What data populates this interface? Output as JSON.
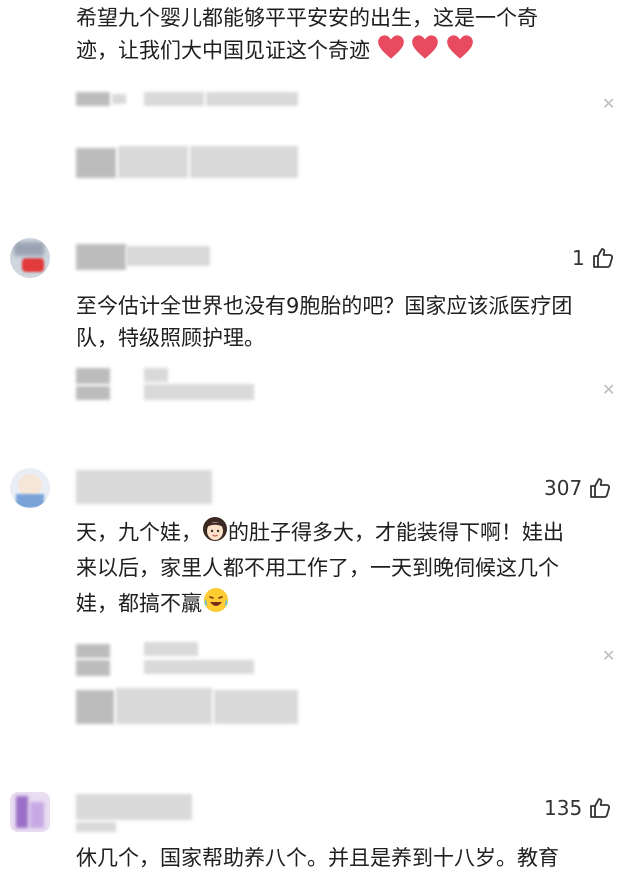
{
  "comments": [
    {
      "text": "希望九个婴儿都能够平平安安的出生，这是一个奇迹，让我们大中国见证这个奇迹",
      "line1": "希望九个婴儿都能够平平安安的出生，这是一个奇",
      "line2": "迹，让我们大中国见证这个奇迹",
      "emojis": [
        "heart-icon",
        "heart-icon",
        "heart-icon"
      ]
    },
    {
      "likes": "1",
      "line1": "至今估计全世界也没有9胞胎的吧？国家应该派医疗团",
      "line2": "队，特级照顾护理。"
    },
    {
      "likes": "307",
      "line1a": "天，九个娃，",
      "line1b": "的肚子得多大，才能装得下啊！娃出",
      "line2": "来以后，家里人都不用工作了，一天到晚伺候这几个",
      "line3": "娃，都搞不羸",
      "emojis": [
        "woman-face-icon",
        "laughing-crying-icon"
      ]
    },
    {
      "likes": "135",
      "line1": "休几个，国家帮助养八个。并且是养到十八岁。教育"
    }
  ],
  "colors": {
    "accent": "#e84a5f",
    "blur": "#d9d9d9",
    "text": "#1f1f1f"
  }
}
